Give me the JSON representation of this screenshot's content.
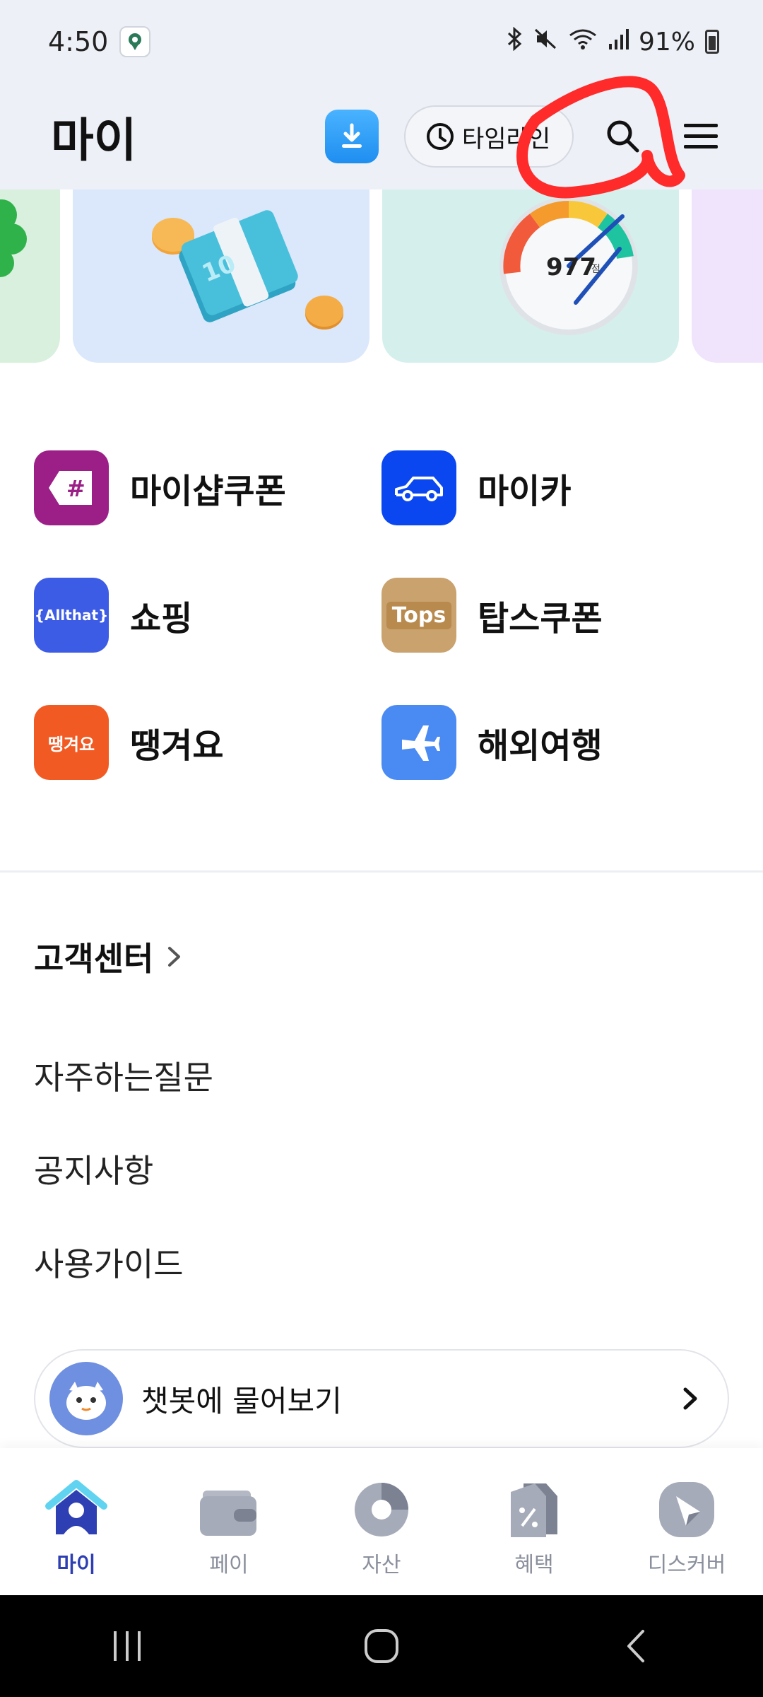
{
  "status_bar": {
    "time": "4:50",
    "battery": "91%",
    "app_icon": "map-pin-icon",
    "icons": [
      "bluetooth-icon",
      "mute-icon",
      "wifi-icon",
      "signal-icon",
      "battery-icon"
    ]
  },
  "header": {
    "title": "마이",
    "download_icon": "download-icon",
    "timeline_label": "타임라인",
    "search_icon": "search-icon",
    "menu_icon": "hamburger-menu-icon"
  },
  "banners": {
    "score_value": "977",
    "score_unit": "점"
  },
  "services": [
    {
      "label": "마이샵쿠폰",
      "icon": "hashtag-tag-icon",
      "color": "#9b1f86",
      "glyph": "#"
    },
    {
      "label": "마이카",
      "icon": "car-icon",
      "color": "#0a47f0",
      "glyph": ""
    },
    {
      "label": "쇼핑",
      "icon": "allthat-logo",
      "color": "#3d5ce6",
      "glyph": "{Allthat}"
    },
    {
      "label": "탑스쿠폰",
      "icon": "tops-logo",
      "color": "#c9a26e",
      "glyph": "Tops"
    },
    {
      "label": "땡겨요",
      "icon": "ddaeng-logo",
      "color": "#f15a22",
      "glyph": "땡겨요"
    },
    {
      "label": "해외여행",
      "icon": "airplane-icon",
      "color": "#4a8af3",
      "glyph": "✈"
    }
  ],
  "customer_center": {
    "title": "고객센터",
    "links": [
      "자주하는질문",
      "공지사항",
      "사용가이드"
    ]
  },
  "chatbot": {
    "label": "챗봇에 물어보기"
  },
  "bottom_nav": {
    "items": [
      {
        "label": "마이",
        "icon": "home-person-icon",
        "active": true
      },
      {
        "label": "페이",
        "icon": "wallet-icon",
        "active": false
      },
      {
        "label": "자산",
        "icon": "pie-chart-icon",
        "active": false
      },
      {
        "label": "혜택",
        "icon": "discount-tag-icon",
        "active": false
      },
      {
        "label": "디스커버",
        "icon": "compass-icon",
        "active": false
      }
    ]
  },
  "colors": {
    "header_bg": "#eef0f7",
    "active_nav": "#2d3fb3",
    "annotation": "#ff2a2a"
  }
}
